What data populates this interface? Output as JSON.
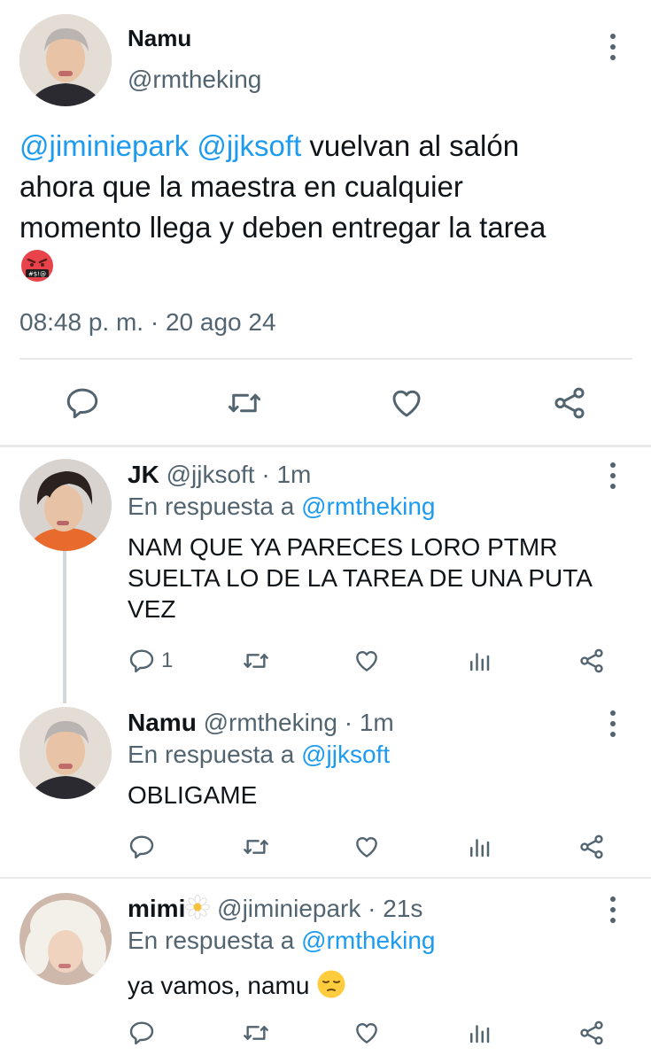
{
  "main_tweet": {
    "name": "Namu",
    "handle": "@rmtheking",
    "mention1": "@jiminiepark",
    "mention2": "@jjksoft",
    "text_line1": "vuelvan al salón",
    "text_line2": "ahora que la maestra en cualquier",
    "text_line3": "momento llega y deben entregar la tarea",
    "emoji": "face-with-symbols-on-mouth",
    "timestamp": "08:48 p. m. · 20 ago 24"
  },
  "replies": [
    {
      "name": "JK",
      "handle": "@jjksoft",
      "time": "· 1m",
      "reply_prefix": "En respuesta a",
      "reply_to": "@rmtheking",
      "text_line1": "NAM QUE YA PARECES LORO PTMR",
      "text_line2": "SUELTA LO DE LA TAREA DE UNA PUTA",
      "text_line3": "VEZ",
      "reply_count": "1"
    },
    {
      "name": "Namu",
      "handle": "@rmtheking",
      "time": "· 1m",
      "reply_prefix": "En respuesta a",
      "reply_to": "@jjksoft",
      "text_line1": "OBLIGAME"
    },
    {
      "name": "mimi",
      "handle": "@jiminiepark",
      "time": "· 21s",
      "reply_prefix": "En respuesta a",
      "reply_to": "@rmtheking",
      "text_line1": "ya vamos, namu",
      "emoji": "pensive-face"
    }
  ],
  "colors": {
    "link": "#1d9bf0",
    "secondary": "#536471",
    "divider": "#e7e9ea"
  }
}
